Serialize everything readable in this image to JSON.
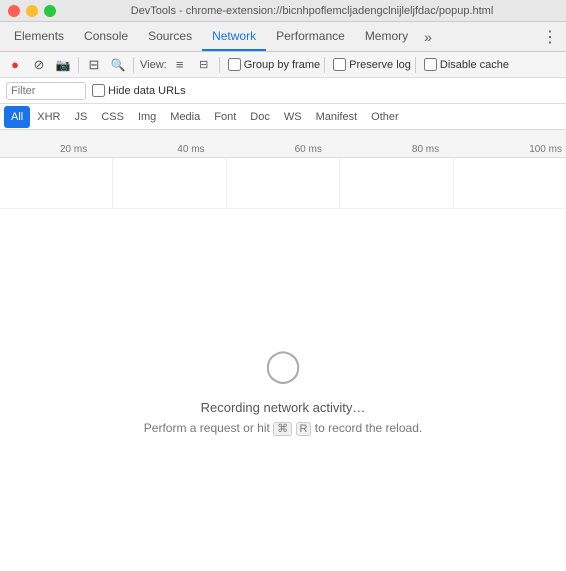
{
  "titleBar": {
    "title": "DevTools - chrome-extension://bicnhpoflemcljadengclnijleljfdac/popup.html"
  },
  "mainTabs": {
    "items": [
      {
        "id": "elements",
        "label": "Elements",
        "active": false
      },
      {
        "id": "console",
        "label": "Console",
        "active": false
      },
      {
        "id": "sources",
        "label": "Sources",
        "active": false
      },
      {
        "id": "network",
        "label": "Network",
        "active": true
      },
      {
        "id": "performance",
        "label": "Performance",
        "active": false
      },
      {
        "id": "memory",
        "label": "Memory",
        "active": false
      }
    ],
    "overflowLabel": "»",
    "moreLabel": "⋮"
  },
  "toolbar": {
    "recordLabel": "●",
    "stopLabel": "⊘",
    "cameraLabel": "📷",
    "filterLabel": "⊟",
    "searchLabel": "🔍",
    "viewLabel": "View:",
    "listViewLabel": "≡",
    "columnViewLabel": "⊟",
    "groupByFrame": {
      "label": "Group by frame",
      "checked": false
    },
    "preserveLog": {
      "label": "Preserve log",
      "checked": false
    },
    "disableCache": {
      "label": "Disable cache",
      "checked": false
    }
  },
  "filterRow": {
    "filterPlaceholder": "Filter",
    "hideDataUrls": {
      "label": "Hide data URLs",
      "checked": false
    }
  },
  "typeTabs": {
    "items": [
      {
        "id": "all",
        "label": "All",
        "active": true
      },
      {
        "id": "xhr",
        "label": "XHR",
        "active": false
      },
      {
        "id": "js",
        "label": "JS",
        "active": false
      },
      {
        "id": "css",
        "label": "CSS",
        "active": false
      },
      {
        "id": "img",
        "label": "Img",
        "active": false
      },
      {
        "id": "media",
        "label": "Media",
        "active": false
      },
      {
        "id": "font",
        "label": "Font",
        "active": false
      },
      {
        "id": "doc",
        "label": "Doc",
        "active": false
      },
      {
        "id": "ws",
        "label": "WS",
        "active": false
      },
      {
        "id": "manifest",
        "label": "Manifest",
        "active": false
      },
      {
        "id": "other",
        "label": "Other",
        "active": false
      }
    ]
  },
  "timeline": {
    "ticks": [
      "20 ms",
      "40 ms",
      "60 ms",
      "80 ms",
      "100 ms"
    ]
  },
  "main": {
    "recordingText": "Recording network activity…",
    "hintText1": "Perform a request or hit ",
    "hintCmd": "⌘",
    "hintKey": "R",
    "hintText2": " to record the reload."
  }
}
